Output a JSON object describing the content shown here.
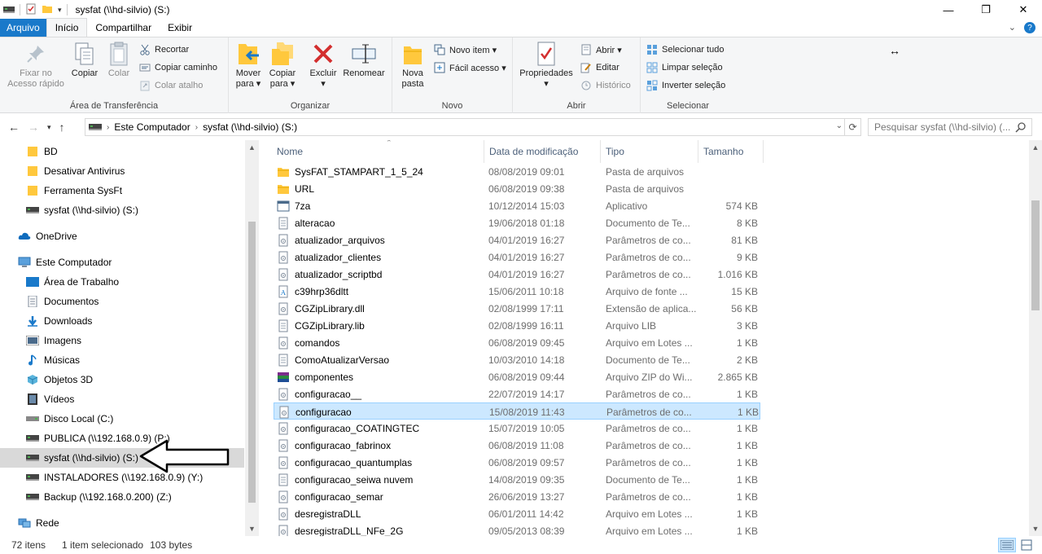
{
  "window": {
    "title": "sysfat (\\\\hd-silvio) (S:)",
    "minimize": "—",
    "maximize": "❐",
    "close": "✕"
  },
  "tabs": {
    "file": "Arquivo",
    "home": "Início",
    "share": "Compartilhar",
    "view": "Exibir"
  },
  "ribbon": {
    "clipboard": {
      "label": "Área de Transferência",
      "pin": "Fixar no\nAcesso rápido",
      "pin_l1": "Fixar no",
      "pin_l2": "Acesso rápido",
      "copy": "Copiar",
      "paste": "Colar",
      "cut": "Recortar",
      "copy_path": "Copiar caminho",
      "paste_shortcut": "Colar atalho"
    },
    "organize": {
      "label": "Organizar",
      "move_l1": "Mover",
      "move_l2": "para ▾",
      "copyto_l1": "Copiar",
      "copyto_l2": "para ▾",
      "delete_l1": "Excluir",
      "delete_l2": "▾",
      "rename": "Renomear"
    },
    "new": {
      "label": "Novo",
      "new_folder_l1": "Nova",
      "new_folder_l2": "pasta",
      "new_item": "Novo item ▾",
      "easy_access": "Fácil acesso ▾"
    },
    "open": {
      "label": "Abrir",
      "properties_l1": "Propriedades",
      "properties_l2": "▾",
      "open": "Abrir ▾",
      "edit": "Editar",
      "history": "Histórico"
    },
    "select": {
      "label": "Selecionar",
      "select_all": "Selecionar tudo",
      "clear": "Limpar seleção",
      "invert": "Inverter seleção"
    }
  },
  "address": {
    "crumb1": "Este Computador",
    "crumb2": "sysfat (\\\\hd-silvio) (S:)",
    "search_placeholder": "Pesquisar sysfat (\\\\hd-silvio) (..."
  },
  "nav": {
    "items": [
      {
        "label": "BD"
      },
      {
        "label": "Desativar Antivirus"
      },
      {
        "label": "Ferramenta SysFt"
      },
      {
        "label": "sysfat (\\\\hd-silvio) (S:)"
      },
      {
        "label": "OneDrive"
      },
      {
        "label": "Este Computador"
      },
      {
        "label": "Área de Trabalho"
      },
      {
        "label": "Documentos"
      },
      {
        "label": "Downloads"
      },
      {
        "label": "Imagens"
      },
      {
        "label": "Músicas"
      },
      {
        "label": "Objetos 3D"
      },
      {
        "label": "Vídeos"
      },
      {
        "label": "Disco Local (C:)"
      },
      {
        "label": "PUBLICA (\\\\192.168.0.9) (P:)"
      },
      {
        "label": "sysfat (\\\\hd-silvio) (S:)"
      },
      {
        "label": "INSTALADORES (\\\\192.168.0.9) (Y:)"
      },
      {
        "label": "Backup (\\\\192.168.0.200) (Z:)"
      },
      {
        "label": "Rede"
      }
    ]
  },
  "columns": {
    "name": "Nome",
    "date": "Data de modificação",
    "type": "Tipo",
    "size": "Tamanho"
  },
  "files": [
    {
      "name": "SysFAT_STAMPART_1_5_24",
      "date": "08/08/2019 09:01",
      "type": "Pasta de arquivos",
      "size": "",
      "icon": "folder"
    },
    {
      "name": "URL",
      "date": "06/08/2019 09:38",
      "type": "Pasta de arquivos",
      "size": "",
      "icon": "folder"
    },
    {
      "name": "7za",
      "date": "10/12/2014 15:03",
      "type": "Aplicativo",
      "size": "574 KB",
      "icon": "app"
    },
    {
      "name": "alteracao",
      "date": "19/06/2018 01:18",
      "type": "Documento de Te...",
      "size": "8 KB",
      "icon": "doc"
    },
    {
      "name": "atualizador_arquivos",
      "date": "04/01/2019 16:27",
      "type": "Parâmetros de co...",
      "size": "81 KB",
      "icon": "cfg"
    },
    {
      "name": "atualizador_clientes",
      "date": "04/01/2019 16:27",
      "type": "Parâmetros de co...",
      "size": "9 KB",
      "icon": "cfg"
    },
    {
      "name": "atualizador_scriptbd",
      "date": "04/01/2019 16:27",
      "type": "Parâmetros de co...",
      "size": "1.016 KB",
      "icon": "cfg"
    },
    {
      "name": "c39hrp36dltt",
      "date": "15/06/2011 10:18",
      "type": "Arquivo de fonte ...",
      "size": "15 KB",
      "icon": "font"
    },
    {
      "name": "CGZipLibrary.dll",
      "date": "02/08/1999 17:11",
      "type": "Extensão de aplica...",
      "size": "56 KB",
      "icon": "cfg"
    },
    {
      "name": "CGZipLibrary.lib",
      "date": "02/08/1999 16:11",
      "type": "Arquivo LIB",
      "size": "3 KB",
      "icon": "doc"
    },
    {
      "name": "comandos",
      "date": "06/08/2019 09:45",
      "type": "Arquivo em Lotes ...",
      "size": "1 KB",
      "icon": "cfg"
    },
    {
      "name": "ComoAtualizarVersao",
      "date": "10/03/2010 14:18",
      "type": "Documento de Te...",
      "size": "2 KB",
      "icon": "doc"
    },
    {
      "name": "componentes",
      "date": "06/08/2019 09:44",
      "type": "Arquivo ZIP do Wi...",
      "size": "2.865 KB",
      "icon": "zip"
    },
    {
      "name": "configuracao__",
      "date": "22/07/2019 14:17",
      "type": "Parâmetros de co...",
      "size": "1 KB",
      "icon": "cfg"
    },
    {
      "name": "configuracao",
      "date": "15/08/2019 11:43",
      "type": "Parâmetros de co...",
      "size": "1 KB",
      "icon": "cfg"
    },
    {
      "name": "configuracao_COATINGTEC",
      "date": "15/07/2019 10:05",
      "type": "Parâmetros de co...",
      "size": "1 KB",
      "icon": "cfg"
    },
    {
      "name": "configuracao_fabrinox",
      "date": "06/08/2019 11:08",
      "type": "Parâmetros de co...",
      "size": "1 KB",
      "icon": "cfg"
    },
    {
      "name": "configuracao_quantumplas",
      "date": "06/08/2019 09:57",
      "type": "Parâmetros de co...",
      "size": "1 KB",
      "icon": "cfg"
    },
    {
      "name": "configuracao_seiwa nuvem",
      "date": "14/08/2019 09:35",
      "type": "Documento de Te...",
      "size": "1 KB",
      "icon": "doc"
    },
    {
      "name": "configuracao_semar",
      "date": "26/06/2019 13:27",
      "type": "Parâmetros de co...",
      "size": "1 KB",
      "icon": "cfg"
    },
    {
      "name": "desregistraDLL",
      "date": "06/01/2011 14:42",
      "type": "Arquivo em Lotes ...",
      "size": "1 KB",
      "icon": "cfg"
    },
    {
      "name": "desregistraDLL_NFe_2G",
      "date": "09/05/2013 08:39",
      "type": "Arquivo em Lotes ...",
      "size": "1 KB",
      "icon": "cfg"
    }
  ],
  "status": {
    "items": "72 itens",
    "selected": "1 item selecionado",
    "size": "103 bytes"
  },
  "colors": {
    "accent": "#1979ca",
    "folder": "#ffc83d",
    "selection": "#cce8ff"
  }
}
